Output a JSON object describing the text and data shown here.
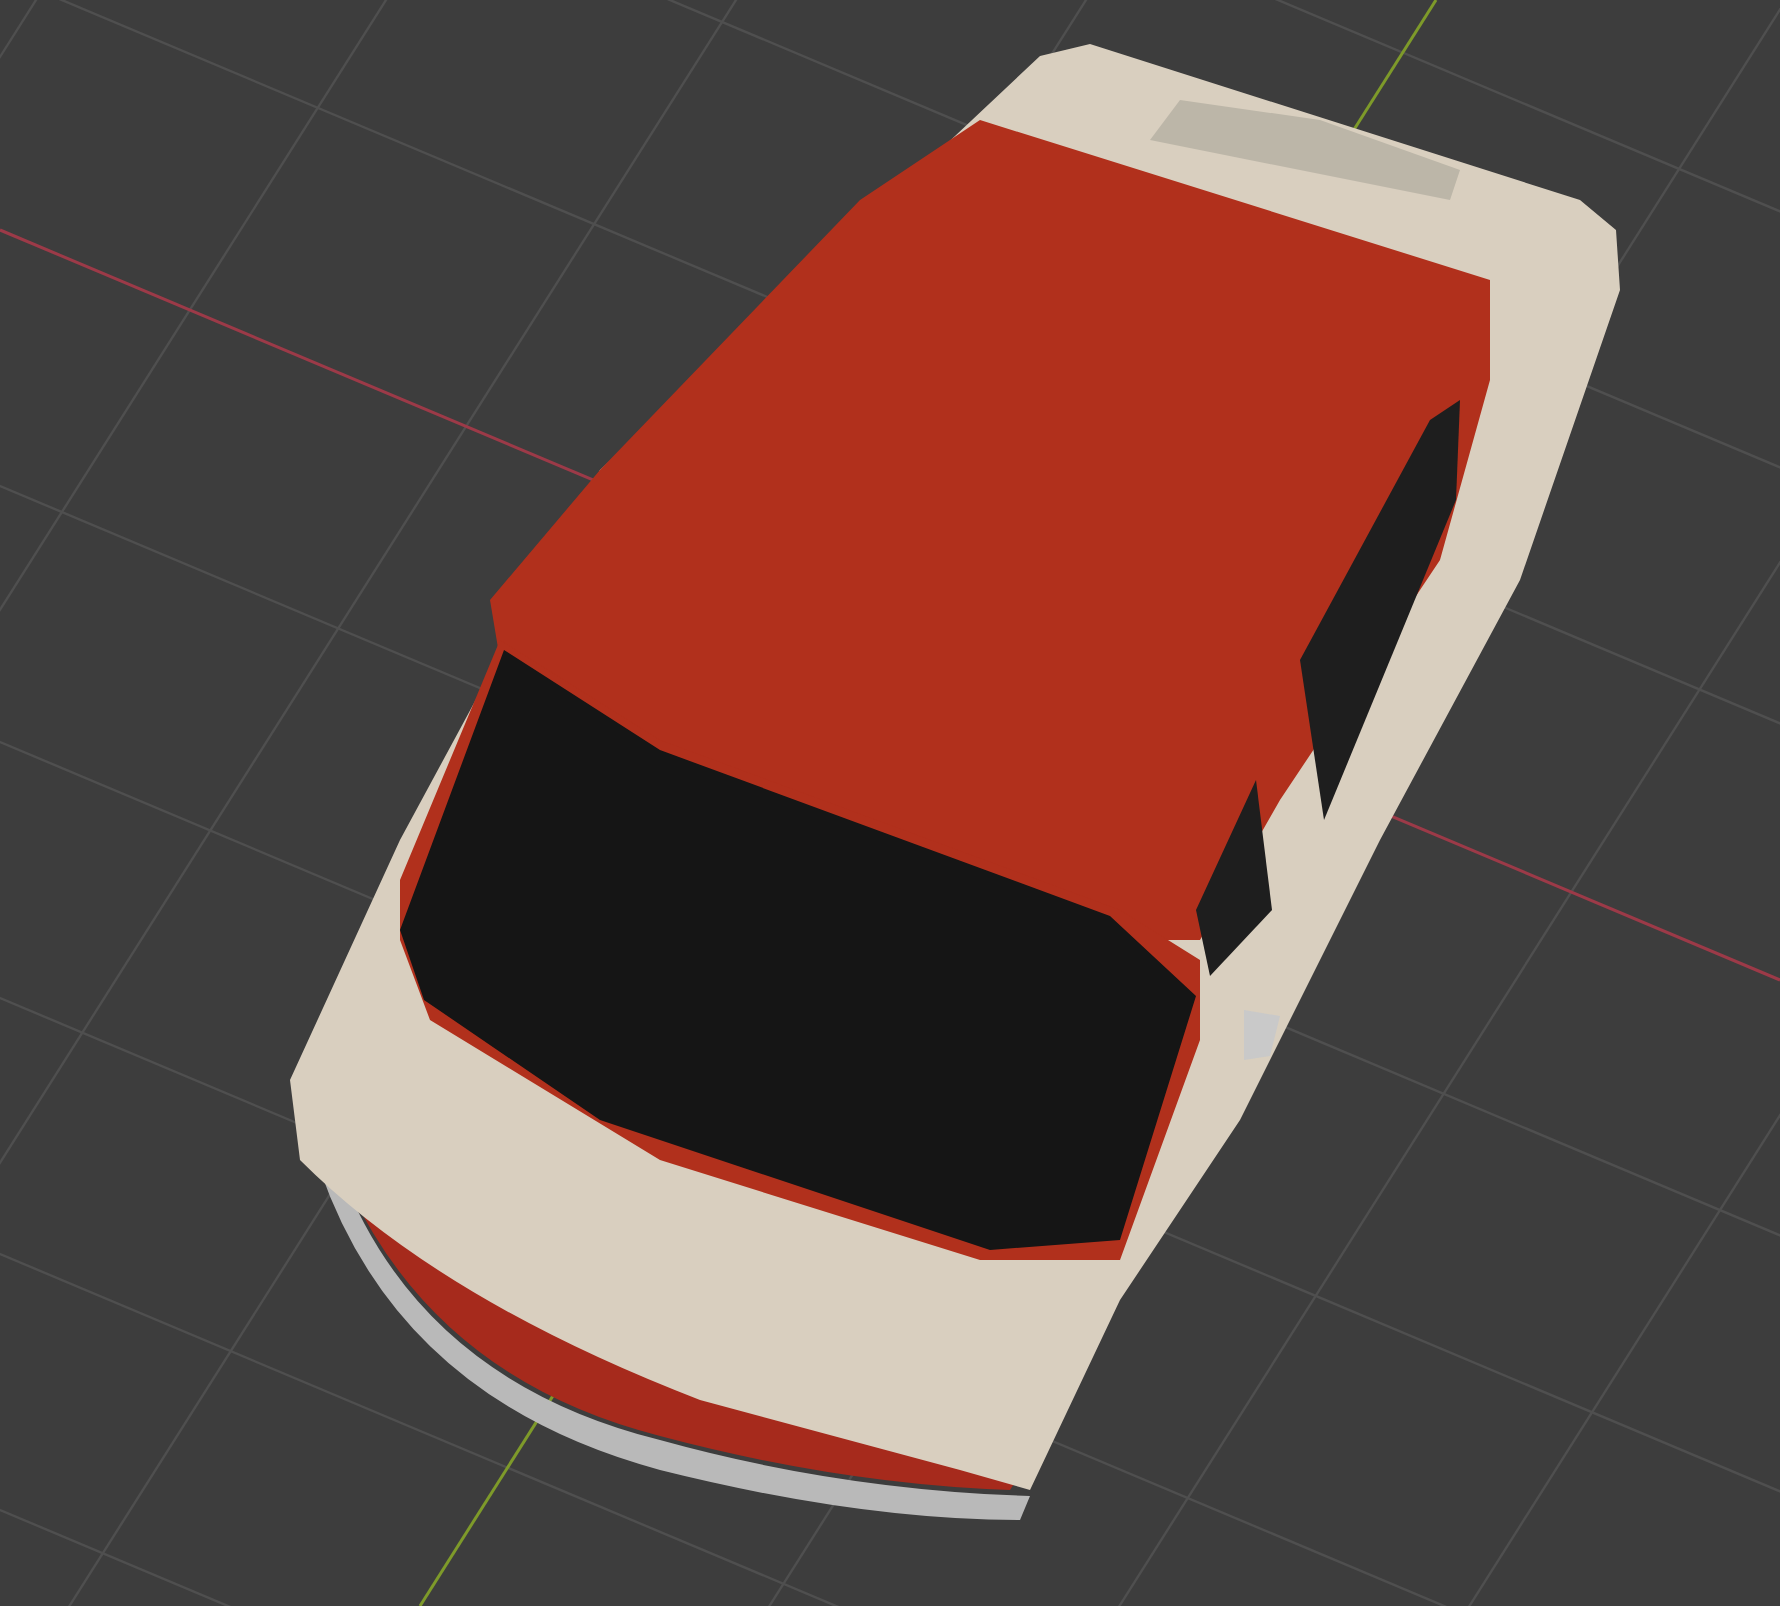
{
  "viewport": {
    "show_grid": true,
    "axes": [
      {
        "kind": "x",
        "color": "#9c3a48"
      },
      {
        "kind": "y",
        "color": "#7e9a2a"
      }
    ]
  }
}
